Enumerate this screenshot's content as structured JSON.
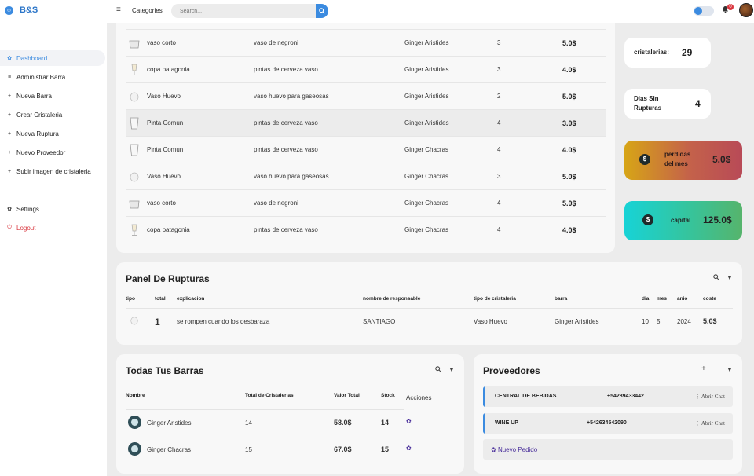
{
  "app": {
    "title": "B&S"
  },
  "header": {
    "categories_label": "Categories",
    "search_placeholder": "Search...",
    "notification_count": "0"
  },
  "sidebar": {
    "items": [
      {
        "label": "Dashboard",
        "icon": "gear-icon"
      },
      {
        "label": "Administrar Barra",
        "icon": "menu-icon"
      },
      {
        "label": "Nueva Barra",
        "icon": "plus-icon"
      },
      {
        "label": "Crear Cristaleria",
        "icon": "plus-icon"
      },
      {
        "label": "Nueva Ruptura",
        "icon": "plus-icon"
      },
      {
        "label": "Nuevo Proveedor",
        "icon": "plus-icon"
      },
      {
        "label": "Subir imagen de cristaleria",
        "icon": "plus-icon"
      },
      {
        "label": "Settings",
        "icon": "gear-icon"
      },
      {
        "label": "Logout",
        "icon": "logout-icon"
      }
    ]
  },
  "glassware": {
    "rows": [
      {
        "name": "vaso corto",
        "description": "vaso de negroni",
        "bar": "Ginger Aristides",
        "qty": "3",
        "cost": "5.0$"
      },
      {
        "name": "copa patagonia",
        "description": "pintas de cerveza vaso",
        "bar": "Ginger Aristides",
        "qty": "3",
        "cost": "4.0$"
      },
      {
        "name": "Vaso Huevo",
        "description": "vaso huevo para gaseosas",
        "bar": "Ginger Aristides",
        "qty": "2",
        "cost": "5.0$"
      },
      {
        "name": "Pinta Comun",
        "description": "pintas de cerveza vaso",
        "bar": "Ginger Aristides",
        "qty": "4",
        "cost": "3.0$"
      },
      {
        "name": "Pinta Comun",
        "description": "pintas de cerveza vaso",
        "bar": "Ginger Chacras",
        "qty": "4",
        "cost": "4.0$"
      },
      {
        "name": "Vaso Huevo",
        "description": "vaso huevo para gaseosas",
        "bar": "Ginger Chacras",
        "qty": "3",
        "cost": "5.0$"
      },
      {
        "name": "vaso corto",
        "description": "vaso de negroni",
        "bar": "Ginger Chacras",
        "qty": "4",
        "cost": "5.0$"
      },
      {
        "name": "copa patagonia",
        "description": "pintas de cerveza vaso",
        "bar": "Ginger Chacras",
        "qty": "4",
        "cost": "4.0$"
      }
    ]
  },
  "stats": {
    "cristalerias": {
      "label": "cristalerias:",
      "value": "29"
    },
    "dias": {
      "label_1": "Dias Sin",
      "label_2": "Rupturas",
      "value": "4"
    },
    "perdidas": {
      "label_1": "perdidas",
      "label_2": "del mes",
      "value": "5.0$",
      "icon": "$"
    },
    "capital": {
      "label": "capital",
      "value": "125.0$",
      "icon": "$"
    }
  },
  "rupturas": {
    "title": "Panel De Rupturas",
    "headers": {
      "tipo": "tipo",
      "total": "total",
      "explicacion": "explicacion",
      "responsable": "nombre de responsable",
      "tipo_cristaleria": "tipo de cristaleria",
      "barra": "barra",
      "dia": "dia",
      "mes": "mes",
      "anio": "anio",
      "coste": "coste"
    },
    "row": {
      "total": "1",
      "explicacion": "se rompen cuando los desbaraza",
      "responsable": "SANTIAGO",
      "tipo_cristaleria": "Vaso Huevo",
      "barra": "Ginger Aristides",
      "dia": "10",
      "mes": "5",
      "anio": "2024",
      "coste": "5.0$"
    }
  },
  "barras": {
    "title": "Todas Tus Barras",
    "headers": {
      "nombre": "Nombre",
      "total": "Total de Cristalerias",
      "valor": "Valor Total",
      "stock": "Stock",
      "acciones": "Acciones"
    },
    "rows": [
      {
        "name": "Ginger Aristides",
        "total": "14",
        "valor": "58.0$",
        "stock": "14"
      },
      {
        "name": "Ginger Chacras",
        "total": "15",
        "valor": "67.0$",
        "stock": "15"
      }
    ]
  },
  "proveedores": {
    "title": "Proveedores",
    "add_label": "+",
    "rows": [
      {
        "name": "CENTRAL DE BEBIDAS",
        "phone": "+54289433442",
        "action": "Abrir Chat"
      },
      {
        "name": "WINE UP",
        "phone": "+542634542090",
        "action": "Abrir Chat"
      }
    ],
    "order_label": "Nuevo Pedido"
  },
  "colors": {
    "accent": "#3b8be0",
    "logout": "#d9363e",
    "order": "#4a2f9b"
  }
}
